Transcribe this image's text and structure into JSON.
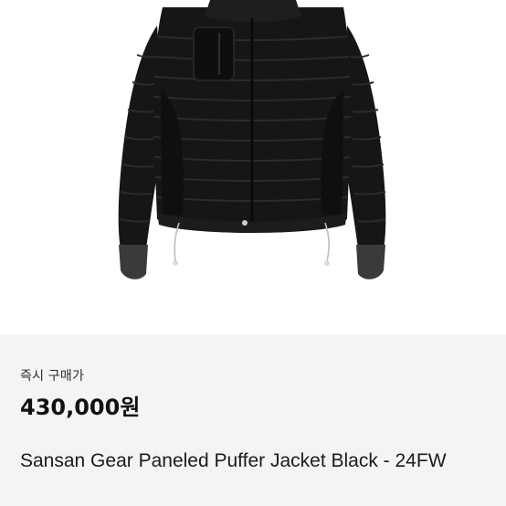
{
  "product": {
    "image_icon": "black-puffer-jacket",
    "purchase_label": "즉시 구매가",
    "price": "430,000원",
    "title": "Sansan Gear Paneled Puffer Jacket Black - 24FW"
  },
  "colors": {
    "panel_background": "#f4f4f5",
    "jacket": "#161616",
    "cuff": "#3a3a3c"
  }
}
